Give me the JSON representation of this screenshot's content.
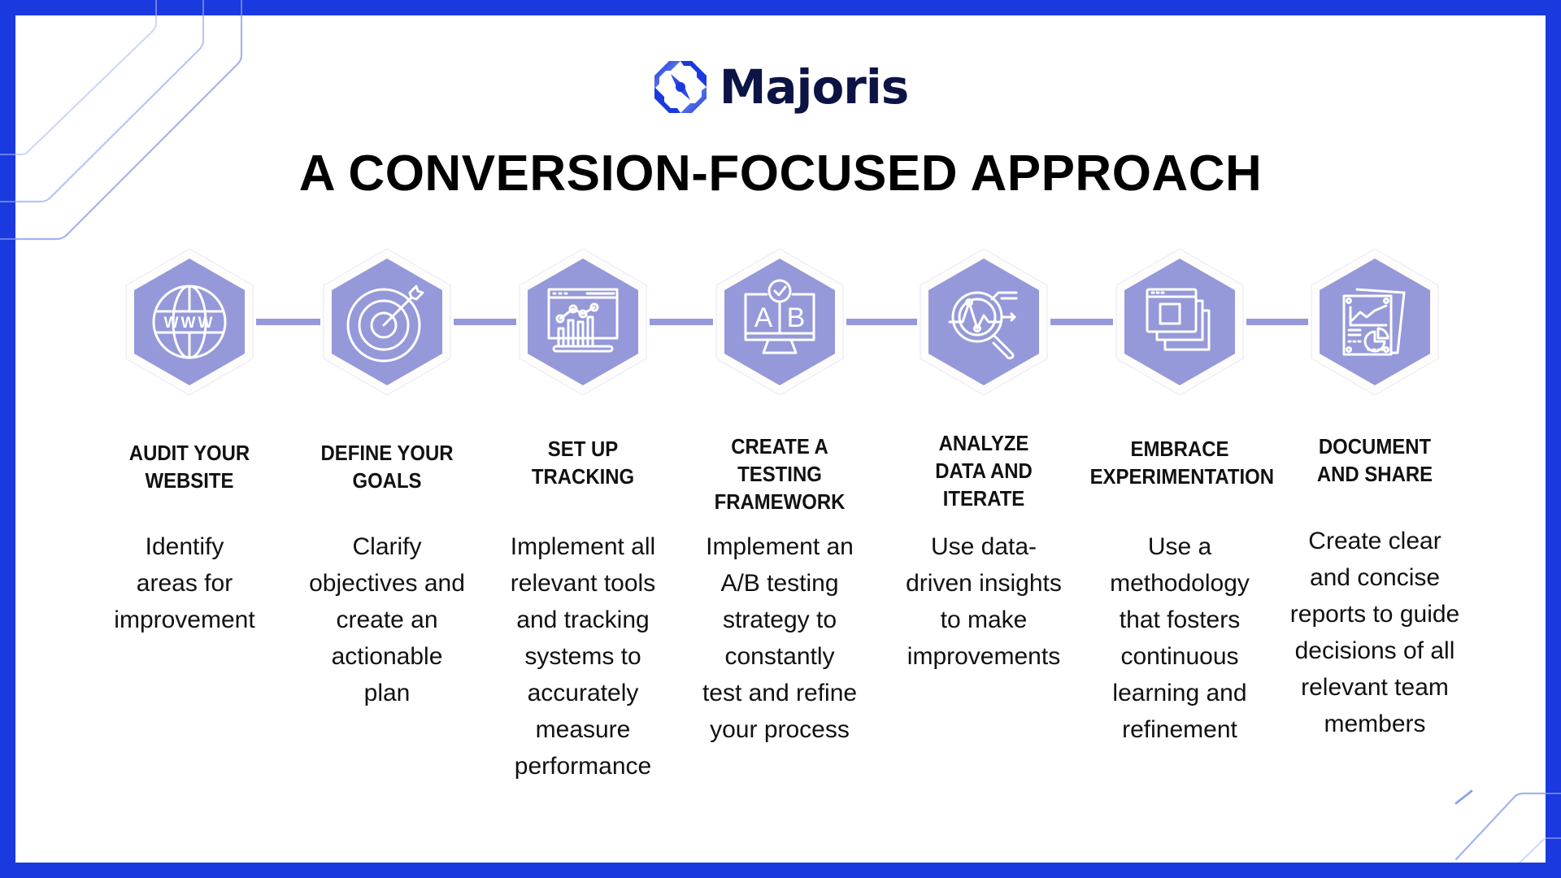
{
  "brand": {
    "name": "Majoris",
    "logo_icon": "octagon-swirl-logo-icon",
    "primary_color": "#1a3ae0",
    "navy_color": "#0c1445"
  },
  "page_title": "A CONVERSION-FOCUSED APPROACH",
  "colors": {
    "hexagon_fill": "#9599d9",
    "connector": "#9599d9",
    "frame": "#1a3ae0",
    "deco_lines": "#a9b6f3"
  },
  "steps": [
    {
      "icon": "globe-www-icon",
      "title_lines": [
        "AUDIT YOUR",
        "WEBSITE"
      ],
      "desc_lines": [
        "Identify",
        "areas for",
        "improvement"
      ]
    },
    {
      "icon": "target-arrow-icon",
      "title_lines": [
        "DEFINE YOUR",
        "GOALS"
      ],
      "desc_lines": [
        "Clarify",
        "objectives and",
        "create an",
        "actionable",
        "plan"
      ]
    },
    {
      "icon": "analytics-dashboard-icon",
      "title_lines": [
        "SET UP",
        "TRACKING"
      ],
      "desc_lines": [
        "Implement all",
        "relevant tools",
        "and tracking",
        "systems to",
        "accurately",
        "measure",
        "performance"
      ]
    },
    {
      "icon": "ab-test-monitor-icon",
      "title_lines": [
        "CREATE A",
        "TESTING",
        "FRAMEWORK"
      ],
      "desc_lines": [
        "Implement an",
        "A/B testing",
        "strategy to",
        "constantly",
        "test and refine",
        "your process"
      ]
    },
    {
      "icon": "magnifier-data-icon",
      "title_lines": [
        "ANALYZE",
        "DATA AND",
        "ITERATE"
      ],
      "desc_lines": [
        "Use data-",
        "driven insights",
        "to make",
        "improvements"
      ]
    },
    {
      "icon": "stacked-windows-icon",
      "title_lines": [
        "EMBRACE",
        "EXPERIMENTATION"
      ],
      "desc_lines": [
        "Use a",
        "methodology",
        "that fosters",
        "continuous",
        "learning and",
        "refinement"
      ]
    },
    {
      "icon": "report-document-icon",
      "title_lines": [
        "DOCUMENT",
        "AND SHARE"
      ],
      "desc_lines": [
        "Create clear",
        "and concise",
        "reports to guide",
        "decisions of all",
        "relevant team",
        "members"
      ]
    }
  ]
}
